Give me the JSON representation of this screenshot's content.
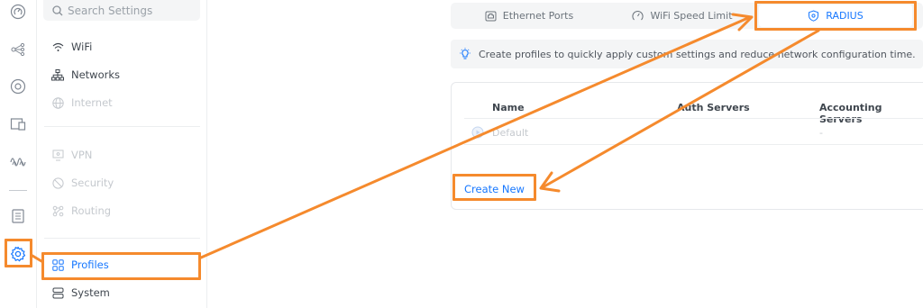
{
  "sidebar": {
    "search": {
      "placeholder": "Search Settings",
      "value": ""
    },
    "items": [
      {
        "label": "WiFi",
        "icon": "wifi-icon",
        "state": "normal"
      },
      {
        "label": "Networks",
        "icon": "network-tree-icon",
        "state": "normal"
      },
      {
        "label": "Internet",
        "icon": "globe-icon",
        "state": "disabled"
      },
      {
        "label": "VPN",
        "icon": "vpn-icon",
        "state": "disabled"
      },
      {
        "label": "Security",
        "icon": "shield-icon",
        "state": "disabled"
      },
      {
        "label": "Routing",
        "icon": "routing-icon",
        "state": "disabled"
      },
      {
        "label": "Profiles",
        "icon": "profiles-grid-icon",
        "state": "active"
      },
      {
        "label": "System",
        "icon": "system-server-icon",
        "state": "normal"
      }
    ]
  },
  "rail": {
    "icons": [
      "dashboard-icon",
      "topology-icon",
      "devices-icon",
      "clients-icon",
      "insights-icon",
      "logs-icon",
      "settings-gear-icon"
    ],
    "active": "settings-gear-icon"
  },
  "tabs": [
    {
      "label": "Ethernet Ports",
      "icon": "ethernet-port-icon",
      "active": false
    },
    {
      "label": "WiFi Speed Limit",
      "icon": "speedometer-icon",
      "active": false
    },
    {
      "label": "RADIUS",
      "icon": "radius-shield-icon",
      "active": true
    }
  ],
  "banner": {
    "icon": "lightbulb-icon",
    "text": "Create profiles to quickly apply custom settings and reduce network configuration time."
  },
  "table": {
    "headers": [
      "Name",
      "Auth Servers",
      "Accounting Servers"
    ],
    "rows": [
      {
        "name": "Default",
        "auth": "",
        "accounting": "-"
      }
    ]
  },
  "actions": {
    "create_new": "Create New"
  },
  "colors": {
    "accent": "#1677ff",
    "annotation": "#f58a2d",
    "disabled": "#c5c9ce"
  }
}
